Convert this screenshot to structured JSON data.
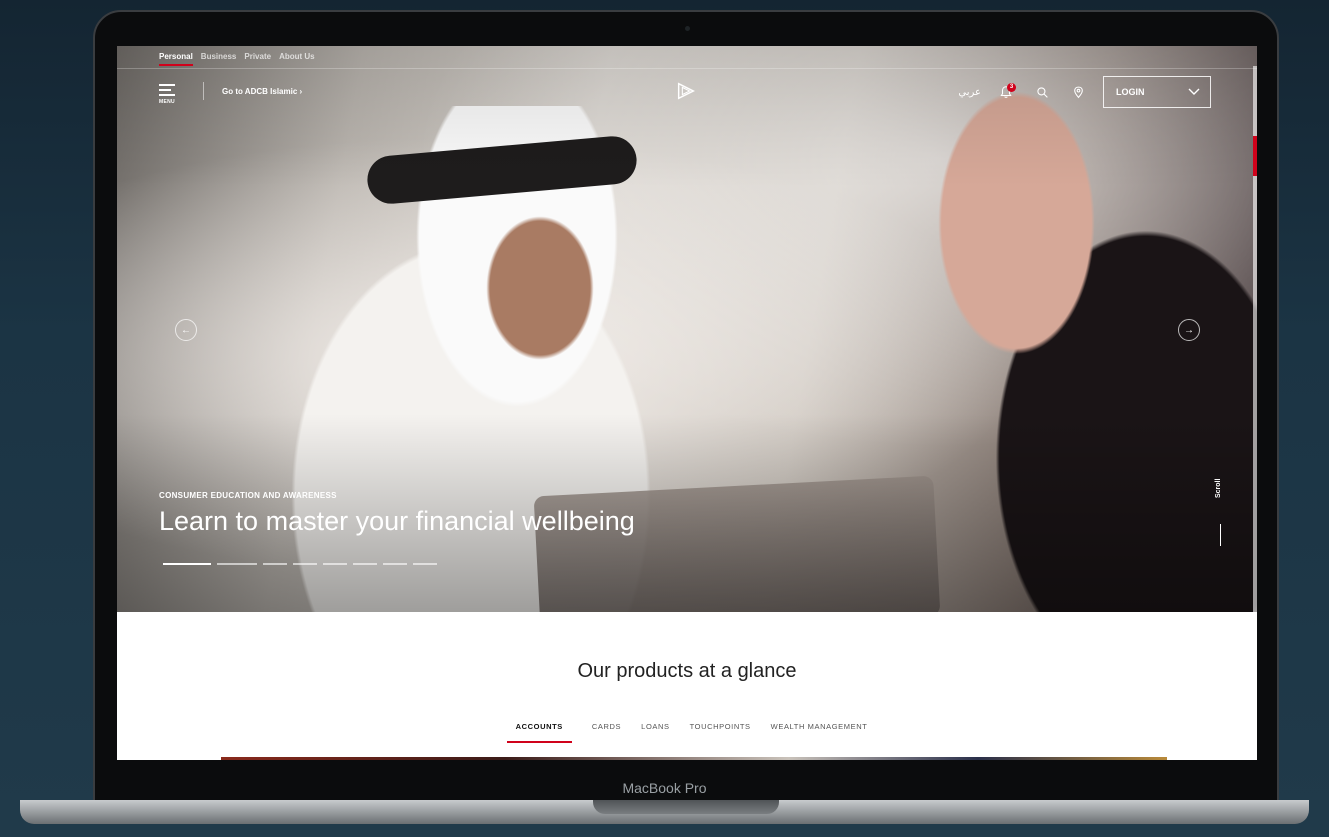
{
  "device": {
    "label": "MacBook Pro"
  },
  "topnav": {
    "items": [
      "Personal",
      "Business",
      "Private",
      "About Us"
    ],
    "active": "Personal"
  },
  "header": {
    "menu_label": "MENU",
    "goto_label": "Go to  ADCB Islamic  ›",
    "arabic_label": "عربي",
    "notification_count": "3",
    "login_label": "LOGIN"
  },
  "hero": {
    "eyebrow": "CONSUMER EDUCATION AND AWARENESS",
    "title": "Learn to master your financial wellbeing",
    "prev": "←",
    "next": "→",
    "scroll_label": "Scroll",
    "slide_count": 8,
    "active_slide": 1
  },
  "products": {
    "title": "Our products at a glance",
    "tabs": [
      "ACCOUNTS",
      "CARDS",
      "LOANS",
      "TOUCHPOINTS",
      "WEALTH MANAGEMENT"
    ],
    "active_tab": "ACCOUNTS"
  },
  "colors": {
    "accent": "#d0021b",
    "background": "#1b3444"
  }
}
